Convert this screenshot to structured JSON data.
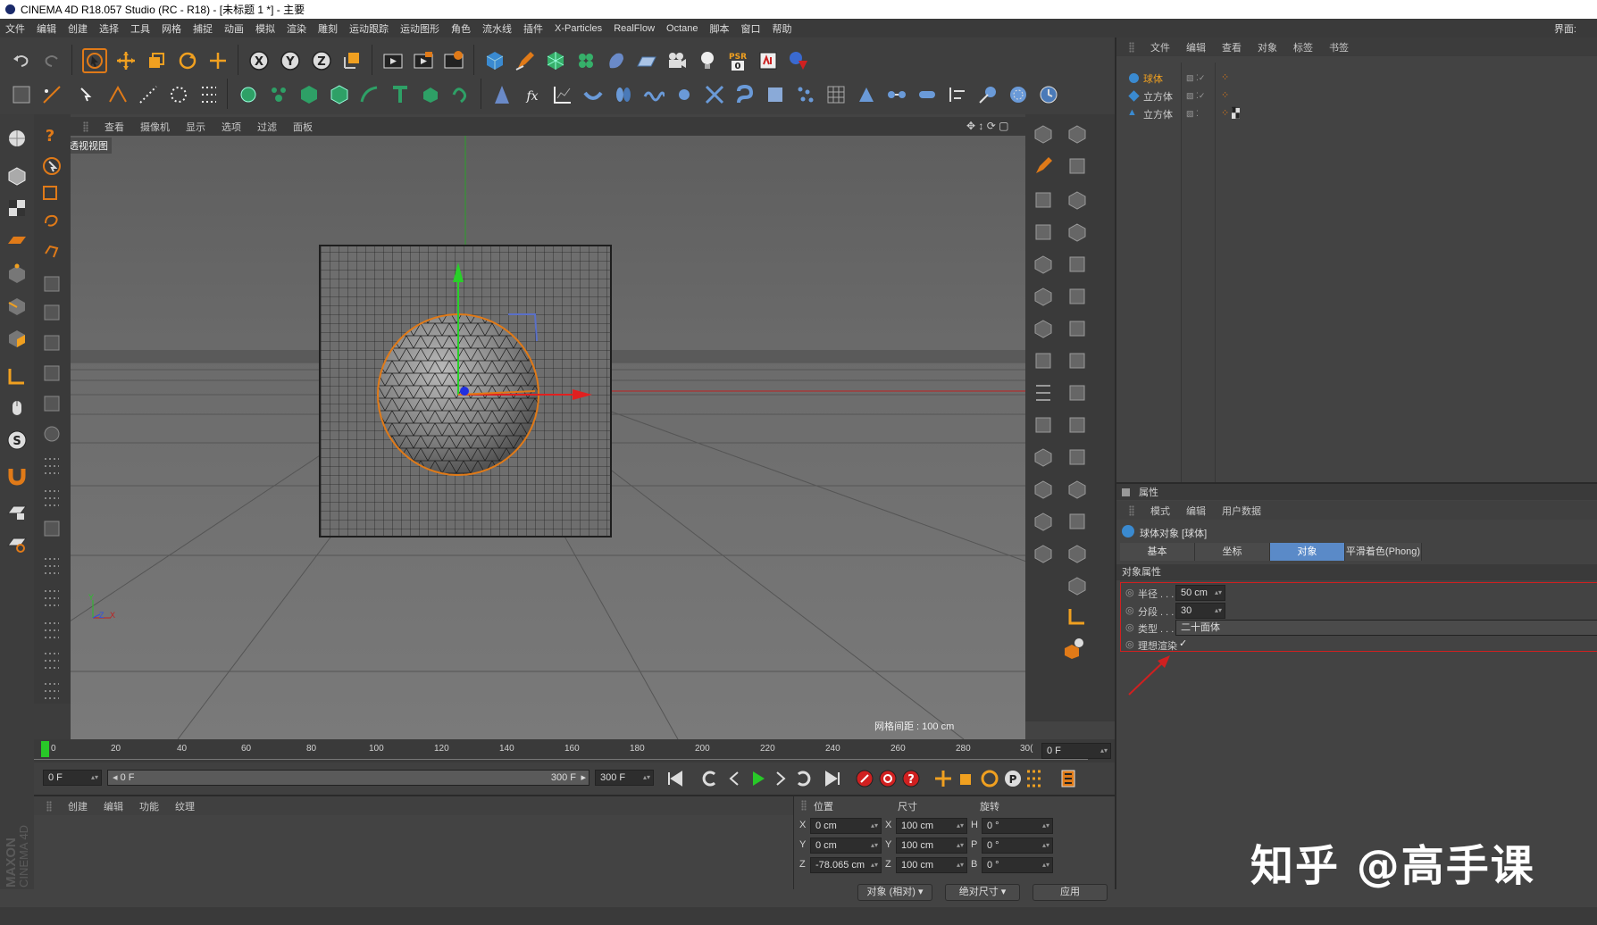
{
  "window": {
    "title": "CINEMA 4D R18.057 Studio (RC - R18) - [未标题 1 *] - 主要"
  },
  "menu": {
    "items": [
      "文件",
      "编辑",
      "创建",
      "选择",
      "工具",
      "网格",
      "捕捉",
      "动画",
      "模拟",
      "渲染",
      "雕刻",
      "运动跟踪",
      "运动图形",
      "角色",
      "流水线",
      "插件",
      "X-Particles",
      "RealFlow",
      "Octane",
      "脚本",
      "窗口",
      "帮助"
    ],
    "layout_label": "界面:"
  },
  "toolbar": {
    "axis_x": "X",
    "axis_y": "Y",
    "axis_z": "Z",
    "psr_top": "PSR",
    "psr_bottom": "0"
  },
  "viewport": {
    "menu": [
      "查看",
      "摄像机",
      "显示",
      "选项",
      "过滤",
      "面板"
    ],
    "label": "透视视图",
    "grid_spacing": "网格间距 : 100 cm",
    "axis_y_label": "Y",
    "axis_x_label": "X",
    "axis_z_label": "Z"
  },
  "object_manager": {
    "menu": [
      "文件",
      "编辑",
      "查看",
      "对象",
      "标签",
      "书签"
    ],
    "objects": [
      {
        "name": "球体",
        "selected": true
      },
      {
        "name": "立方体",
        "selected": false
      },
      {
        "name": "立方体",
        "selected": false
      }
    ]
  },
  "attributes": {
    "title": "属性",
    "menu": [
      "模式",
      "编辑",
      "用户数据"
    ],
    "object_label": "球体对象 [球体]",
    "tabs": [
      "基本",
      "坐标",
      "对象",
      "平滑着色(Phong)"
    ],
    "active_tab": "对象",
    "section": "对象属性",
    "props": [
      {
        "label": "半径 . . .",
        "value": "50 cm"
      },
      {
        "label": "分段 . . .",
        "value": "30"
      },
      {
        "label": "类型 . . .",
        "value": "二十面体"
      },
      {
        "label": "理想渲染",
        "value": "✓"
      }
    ]
  },
  "timeline": {
    "ticks": [
      "0",
      "20",
      "40",
      "60",
      "80",
      "100",
      "120",
      "140",
      "160",
      "180",
      "200",
      "220",
      "240",
      "260",
      "280",
      "30("
    ],
    "current_frame": "0 F",
    "start_frame": "0 F",
    "range_start": "0 F",
    "range_end": "300 F",
    "end_frame": "300 F"
  },
  "material_manager": {
    "menu": [
      "创建",
      "编辑",
      "功能",
      "纹理"
    ]
  },
  "coordinates": {
    "headers": [
      "位置",
      "尺寸",
      "旋转"
    ],
    "rows": [
      {
        "axis": "X",
        "pos": "0 cm",
        "size_axis": "X",
        "size": "100 cm",
        "rot_axis": "H",
        "rot": "0 °"
      },
      {
        "axis": "Y",
        "pos": "0 cm",
        "size_axis": "Y",
        "size": "100 cm",
        "rot_axis": "P",
        "rot": "0 °"
      },
      {
        "axis": "Z",
        "pos": "-78.065 cm",
        "size_axis": "Z",
        "size": "100 cm",
        "rot_axis": "B",
        "rot": "0 °"
      }
    ],
    "mode": "对象 (相对)",
    "size_mode": "绝对尺寸",
    "apply": "应用"
  },
  "branding": {
    "maxon": "MAXON",
    "c4d": "CINEMA 4D"
  },
  "watermark": "知乎 @高手课",
  "colors": {
    "accent": "#5a8ac8",
    "highlight": "#e07a18",
    "annotation": "#e02020"
  }
}
